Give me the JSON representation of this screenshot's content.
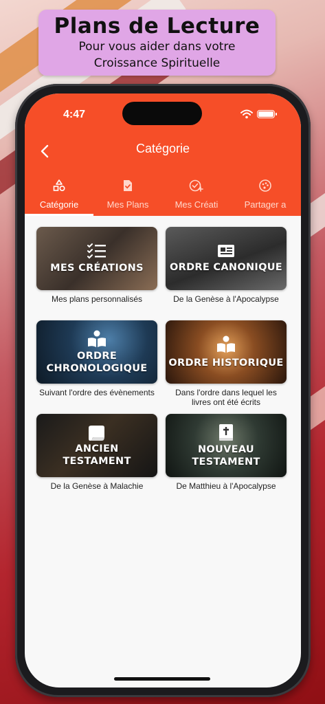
{
  "banner": {
    "title": "Plans de Lecture",
    "subtitle_line1": "Pour vous aider dans votre",
    "subtitle_line2": "Croissance Spirituelle"
  },
  "status_bar": {
    "time": "4:47"
  },
  "app_bar": {
    "title": "Catégorie",
    "accent_color": "#f64e28"
  },
  "tabs": [
    {
      "label": "Catégorie",
      "icon": "shapes-icon",
      "active": true
    },
    {
      "label": "Mes Plans",
      "icon": "document-check-icon",
      "active": false
    },
    {
      "label": "Mes Créati",
      "icon": "check-circle-plus-icon",
      "active": false
    },
    {
      "label": "Partager a",
      "icon": "palette-icon",
      "active": false
    }
  ],
  "cards": [
    {
      "title_line1": "MES CRÉATIONS",
      "title_line2": "",
      "caption": "Mes plans personnalisés",
      "icon": "checklist-icon"
    },
    {
      "title_line1": "ORDRE CANONIQUE",
      "title_line2": "",
      "caption": "De la Genèse à l'Apocalypse",
      "icon": "newspaper-icon"
    },
    {
      "title_line1": "ORDRE",
      "title_line2": "CHRONOLOGIQUE",
      "caption": "Suivant l'ordre des évènements",
      "icon": "reader-icon"
    },
    {
      "title_line1": "ORDRE HISTORIQUE",
      "title_line2": "",
      "caption": "Dans l'ordre dans lequel les livres ont été écrits",
      "icon": "reader-icon"
    },
    {
      "title_line1": "ANCIEN",
      "title_line2": "TESTAMENT",
      "caption": "De la Genèse à Malachie",
      "icon": "scroll-icon"
    },
    {
      "title_line1": "NOUVEAU",
      "title_line2": "TESTAMENT",
      "caption": "De Matthieu à l'Apocalypse",
      "icon": "bible-icon"
    }
  ]
}
